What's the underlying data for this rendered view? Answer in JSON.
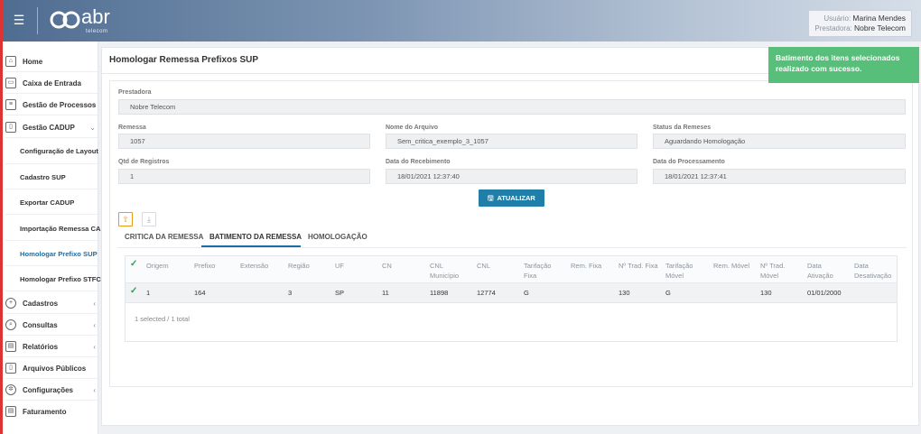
{
  "header": {
    "logo_text": "abr",
    "logo_sub": "telecom",
    "user_label": "Usuário:",
    "user_value": "Marina Mendes",
    "prestadora_label": "Prestadora:",
    "prestadora_value": "Nobre Telecom"
  },
  "sidebar": {
    "items": [
      {
        "label": "Home",
        "icon": "home-icon"
      },
      {
        "label": "Caixa de Entrada",
        "icon": "inbox-icon"
      },
      {
        "label": "Gestão de Processos",
        "icon": "process-icon"
      },
      {
        "label": "Gestão CADUP",
        "icon": "document-icon"
      },
      {
        "label": "Cadastros",
        "icon": "plus-circle-icon"
      },
      {
        "label": "Consultas",
        "icon": "search-icon"
      },
      {
        "label": "Relatórios",
        "icon": "report-icon"
      },
      {
        "label": "Arquivos Públicos",
        "icon": "file-icon"
      },
      {
        "label": "Configurações",
        "icon": "gear-icon"
      },
      {
        "label": "Faturamento",
        "icon": "invoice-icon"
      }
    ],
    "subitems": [
      "Configuração de Layout",
      "Cadastro SUP",
      "Exportar CADUP",
      "Importação Remessa CADUP",
      "Homologar Prefixo SUP",
      "Homologar Prefixo STFC..."
    ]
  },
  "page": {
    "title": "Homologar Remessa Prefixos SUP"
  },
  "form": {
    "prestadora_label": "Prestadora",
    "prestadora_value": "Nobre Telecom",
    "remessa_label": "Remessa",
    "remessa_value": "1057",
    "arquivo_label": "Nome do Arquivo",
    "arquivo_value": "Sem_critica_exemplo_3_1057",
    "status_label": "Status da Remeses",
    "status_value": "Aguardando Homologação",
    "qtd_label": "Qtd de Registros",
    "qtd_value": "1",
    "receb_label": "Data do Recebimento",
    "receb_value": "18/01/2021 12:37:40",
    "proc_label": "Data do Processamento",
    "proc_value": "18/01/2021 12:37:41",
    "update_button": "ATUALIZAR"
  },
  "tabs": [
    "CRITICA DA REMESSA",
    "BATIMENTO DA REMESSA",
    "HOMOLOGAÇÃO"
  ],
  "table": {
    "columns": [
      "Origem",
      "Prefixo",
      "Extensão",
      "Região",
      "UF",
      "CN",
      "CNL Município",
      "CNL",
      "Tarifação Fixa",
      "Rem. Fixa",
      "Nº Trad. Fixa",
      "Tarifação Móvel",
      "Rem. Móvel",
      "Nº Trad. Móvel",
      "Data Ativação",
      "Data Desativação"
    ],
    "row": [
      "1",
      "164",
      "",
      "3",
      "SP",
      "11",
      "11898",
      "12774",
      "G",
      "",
      "130",
      "G",
      "",
      "130",
      "01/01/2000",
      ""
    ],
    "footer": "1 selected / 1 total"
  },
  "toast": {
    "message": "Batimento dos itens selecionados realizado com sucesso."
  }
}
